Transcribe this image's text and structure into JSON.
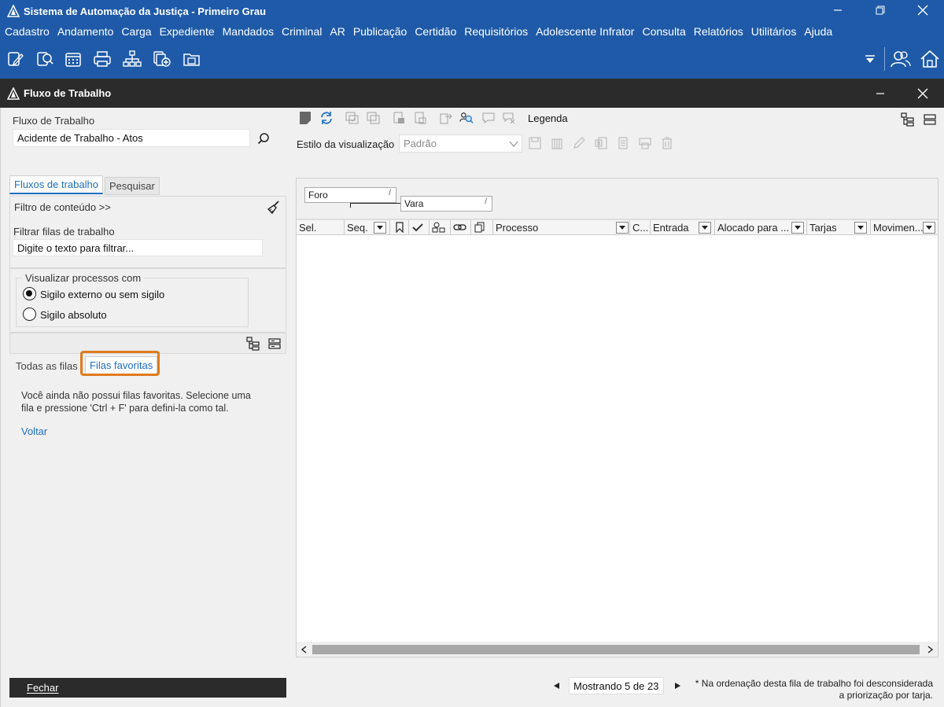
{
  "app": {
    "title": "Sistema de Automação da Justiça - Primeiro Grau"
  },
  "menu": [
    "Cadastro",
    "Andamento",
    "Carga",
    "Expediente",
    "Mandados",
    "Criminal",
    "AR",
    "Publicação",
    "Certidão",
    "Requisitórios",
    "Adolescente Infrator",
    "Consulta",
    "Relatórios",
    "Utilitários",
    "Ajuda"
  ],
  "toolbar_icons": [
    "edit-doc-icon",
    "search-doc-icon",
    "calendar-icon",
    "printer-icon",
    "hierarchy-icon",
    "add-docs-icon",
    "folder-icon"
  ],
  "window": {
    "title": "Fluxo de Trabalho"
  },
  "left": {
    "fluxo_label": "Fluxo de Trabalho",
    "fluxo_value": "Acidente de Trabalho - Atos",
    "tabs": {
      "fluxos": "Fluxos de trabalho",
      "pesquisar": "Pesquisar"
    },
    "filtro_conteudo": "Filtro de conteúdo >>",
    "filtrar_label": "Filtrar filas de trabalho",
    "filtrar_placeholder": "Digite o texto para filtrar...",
    "visualizar_label": "Visualizar processos com",
    "radio_externo": "Sigilo externo ou sem sigilo",
    "radio_absoluto": "Sigilo absoluto",
    "subtabs": {
      "todas": "Todas as filas",
      "favoritas": "Filas favoritas"
    },
    "empty_line1": "Você ainda não possui filas favoritas. Selecione uma",
    "empty_line2": "fila e pressione 'Ctrl + F' para defini-la como tal.",
    "voltar": "Voltar",
    "fechar": "Fechar"
  },
  "right": {
    "legenda": "Legenda",
    "estilo_label": "Estilo da visualização",
    "estilo_value": "Padrão",
    "group_chips": [
      "Foro",
      "Vara"
    ],
    "columns": [
      "Sel.",
      "Seq.",
      "Processo",
      "C...",
      "Entrada",
      "Alocado para ...",
      "Tarjas",
      "Movimen..."
    ],
    "pager_text": "Mostrando 5 de 23",
    "note_line1": "* Na ordenação desta fila de trabalho foi desconsiderada",
    "note_line2": "a priorização por tarja."
  },
  "colors": {
    "accent": "#1e5aa8",
    "dark_bar": "#2b2b2b",
    "highlight": "#e07a1c",
    "link": "#1e6fc0"
  }
}
